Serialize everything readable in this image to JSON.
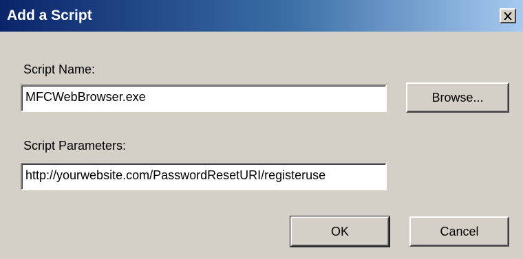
{
  "window": {
    "title": "Add a Script",
    "close_icon": "close-icon"
  },
  "form": {
    "script_name_label": "Script Name:",
    "script_name_value": "MFCWebBrowser.exe",
    "browse_label": "Browse...",
    "script_parameters_label": "Script Parameters:",
    "script_parameters_value": "http://yourwebsite.com/PasswordResetURI/registeruse"
  },
  "buttons": {
    "ok_label": "OK",
    "cancel_label": "Cancel"
  },
  "colors": {
    "titlebar_start": "#0a246a",
    "titlebar_end": "#a6caf0",
    "dialog_face": "#d4d0c8"
  }
}
